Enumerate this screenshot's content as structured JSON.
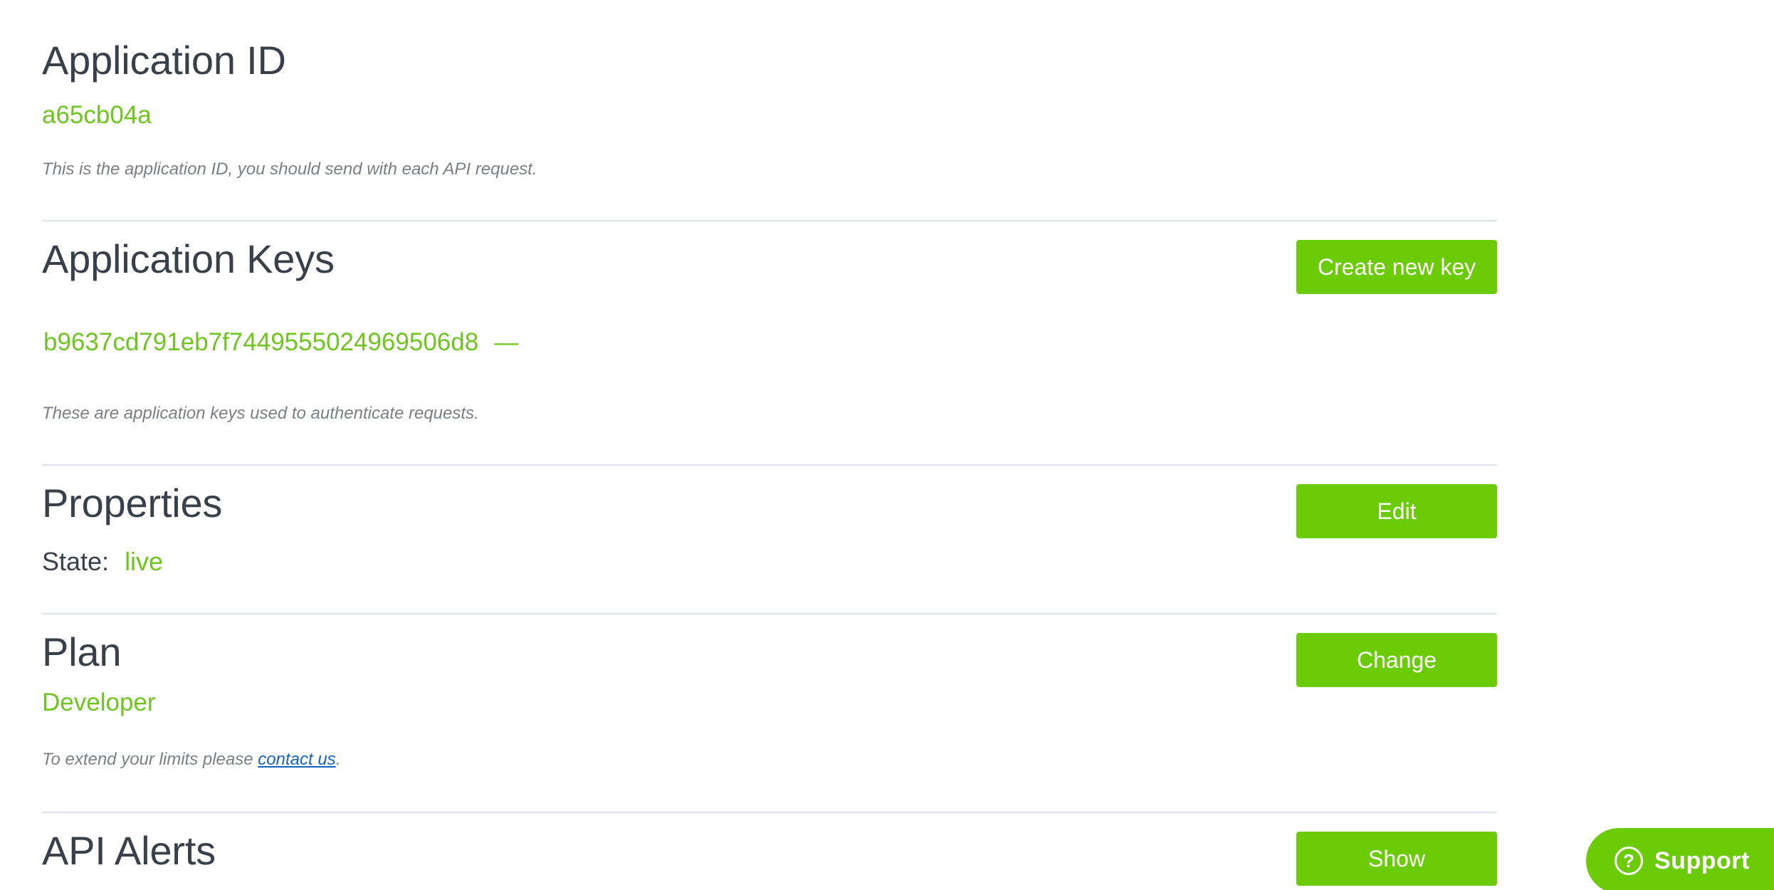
{
  "app_id_section": {
    "title": "Application ID",
    "value": "a65cb04a",
    "note": "This is the application ID, you should send with each API request."
  },
  "app_keys_section": {
    "title": "Application Keys",
    "button_label": "Create new key",
    "keys": [
      {
        "value": "b9637cd791eb7f7449555024969506d8",
        "action": "—"
      }
    ],
    "note": "These are application keys used to authenticate requests."
  },
  "properties_section": {
    "title": "Properties",
    "button_label": "Edit",
    "state_label": "State:",
    "state_value": "live"
  },
  "plan_section": {
    "title": "Plan",
    "button_label": "Change",
    "plan_name": "Developer",
    "note_prefix": "To extend your limits please ",
    "note_link": "contact us",
    "note_suffix": "."
  },
  "alerts_section": {
    "title": "API Alerts",
    "button_label": "Show"
  },
  "support_widget": {
    "icon": "question-circle-icon",
    "label": "Support"
  },
  "colors": {
    "accent_green": "#6bcb06",
    "value_green": "#6fc420",
    "heading": "#3a4049",
    "note": "#7a7f86",
    "link": "#1565c0",
    "divider": "#dde3ea"
  }
}
